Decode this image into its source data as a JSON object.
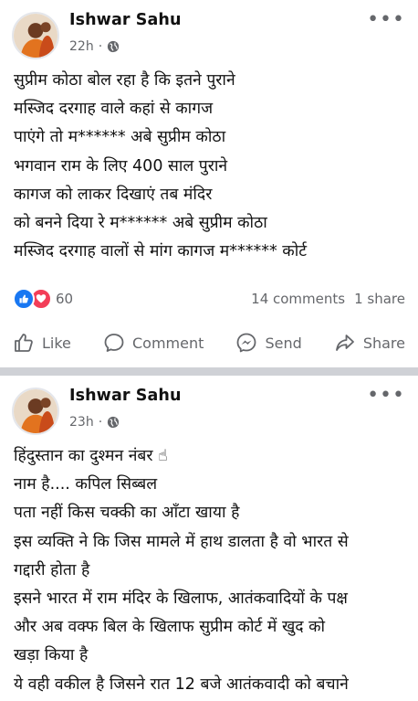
{
  "post1": {
    "author": "Ishwar Sahu",
    "time": "22h",
    "separator": "·",
    "more": "•••",
    "lines": [
      "सुप्रीम कोठा बोल रहा है कि इतने पुराने",
      " मस्जिद दरगाह वाले कहां से कागज",
      " पाएंगे तो म****** अबे सुप्रीम कोठा",
      " भगवान राम के लिए 400 साल पुराने",
      " कागज को लाकर दिखाएं तब मंदिर",
      " को बनने दिया रे म****** अबे सुप्रीम कोठा",
      "मस्जिद दरगाह वालों से मांग कागज म****** कोर्ट"
    ],
    "reaction_count": "60",
    "comments": "14 comments",
    "shares": "1 share",
    "actions": {
      "like": "Like",
      "comment": "Comment",
      "send": "Send",
      "share": "Share"
    }
  },
  "post2": {
    "author": "Ishwar Sahu",
    "time": "23h",
    "separator": "·",
    "more": "•••",
    "lines": [
      "हिंदुस्तान का दुश्मन नंबर ☝",
      "नाम है.... कपिल सिब्बल",
      "पता नहीं किस चक्की का आँटा खाया है",
      "इस व्यक्ति ने कि जिस मामले में हाथ डालता है वो भारत से",
      "गद्दारी होता है",
      "इसने भारत में राम मंदिर के खिलाफ, आतंकवादियों के पक्ष",
      "और अब वक्फ बिल के खिलाफ सुप्रीम कोर्ट में खुद को",
      "खड़ा किया है",
      "ये वही वकील है जिसने रात 12 बजे आतंकवादी को बचाने"
    ]
  },
  "colors": {
    "like_blue": "#1877f2",
    "love_red": "#f33e58",
    "secondary_text": "#65676b",
    "divider": "#cfd1d6"
  },
  "icons": [
    "globe-icon",
    "more-options-icon",
    "like-reaction-icon",
    "love-reaction-icon",
    "thumbs-up-icon",
    "comment-bubble-icon",
    "messenger-send-icon",
    "share-arrow-icon"
  ]
}
